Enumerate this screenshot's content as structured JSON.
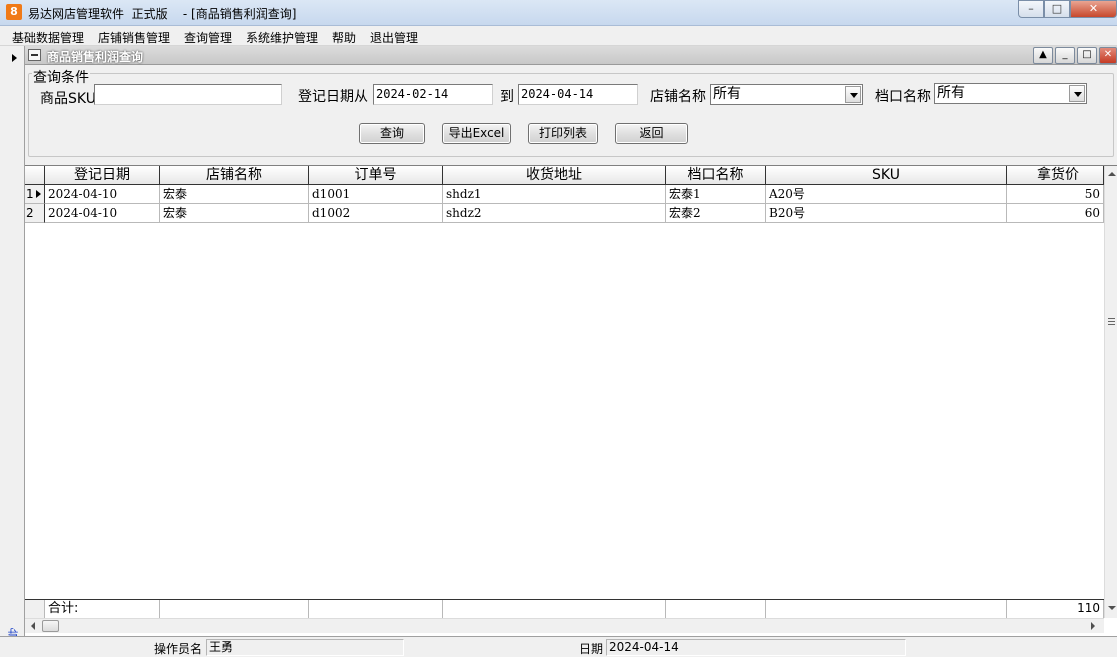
{
  "window": {
    "app_icon": "orange-app-icon",
    "app_icon_glyph": "8",
    "title": "易达网店管理软件  正式版    - [商品销售利润查询]",
    "min_glyph": "–",
    "max_glyph": "□",
    "close_glyph": "✕"
  },
  "menu": {
    "items": [
      "基础数据管理",
      "店铺销售管理",
      "查询管理",
      "系统维护管理",
      "帮助",
      "退出管理"
    ]
  },
  "child_window": {
    "title": "商品销售利润查询",
    "buttons": {
      "up": "▲",
      "min": "_",
      "max": "□",
      "close": "✕"
    }
  },
  "side": {
    "nav_label": "导航向导"
  },
  "query": {
    "group_title": "查询条件",
    "sku_label": "商品SKU",
    "sku_value": "",
    "date_from_label": "登记日期从",
    "date_from_value": "2024-02-14",
    "date_to_label": "到",
    "date_to_value": "2024-04-14",
    "shop_label": "店铺名称",
    "shop_value": "所有",
    "stall_label": "档口名称",
    "stall_value": "所有",
    "buttons": {
      "search": "查询",
      "export": "导出Excel",
      "print": "打印列表",
      "back": "返回"
    }
  },
  "grid": {
    "columns": [
      "登记日期",
      "店铺名称",
      "订单号",
      "收货地址",
      "档口名称",
      "SKU",
      "拿货价"
    ],
    "rows": [
      {
        "index": "1",
        "date": "2024-04-10",
        "shop": "宏泰",
        "order": "d1001",
        "address": "shdz1",
        "stall": "宏泰1",
        "sku": "A20号",
        "price": "50"
      },
      {
        "index": "2",
        "date": "2024-04-10",
        "shop": "宏泰",
        "order": "d1002",
        "address": "shdz2",
        "stall": "宏泰2",
        "sku": "B20号",
        "price": "60"
      }
    ],
    "total_label": "合计:",
    "total_price": "110"
  },
  "status": {
    "operator_label": "操作员名",
    "operator_value": "王勇",
    "date_label": "日期",
    "date_value": "2024-04-14"
  }
}
